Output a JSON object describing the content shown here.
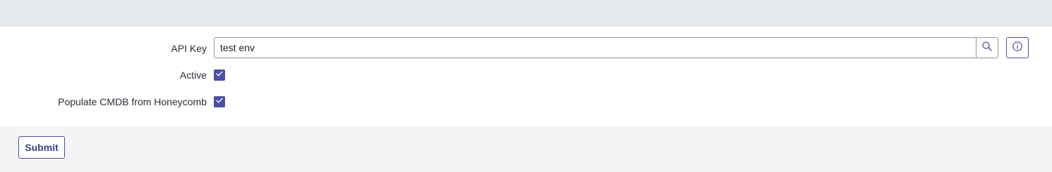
{
  "form": {
    "api_key": {
      "label": "API Key",
      "value": "test env"
    },
    "active": {
      "label": "Active",
      "checked": true
    },
    "populate_cmdb": {
      "label": "Populate CMDB from Honeycomb",
      "checked": true
    }
  },
  "icons": {
    "search": "search-icon",
    "info": "info-icon",
    "check": "checkmark-icon"
  },
  "colors": {
    "accent": "#4b4fa6",
    "topbar": "#e5e8ec",
    "footer": "#f4f4f6"
  },
  "footer": {
    "submit_label": "Submit"
  }
}
